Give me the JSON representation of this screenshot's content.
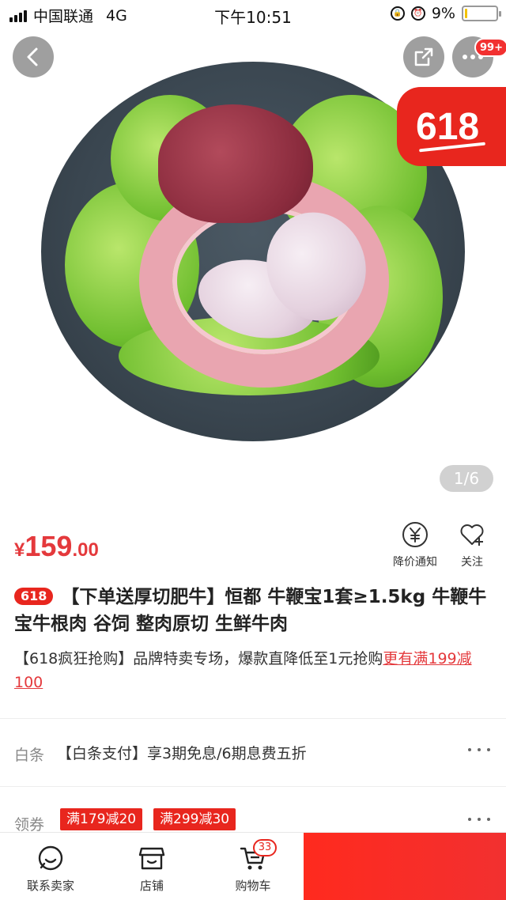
{
  "status_bar": {
    "carrier": "中国联通",
    "network": "4G",
    "time": "下午10:51",
    "battery_percent": "9%",
    "battery_level": 0.09
  },
  "gallery": {
    "pager": "1/6",
    "badge": "99+",
    "promo_tag": "618"
  },
  "price": {
    "currency": "¥",
    "integer": "159",
    "decimal": ".00"
  },
  "actions": {
    "price_alert": "降价通知",
    "follow": "关注"
  },
  "product": {
    "tag": "618",
    "title": "【下单送厚切肥牛】恒都 牛鞭宝1套≥1.5kg 牛鞭牛宝牛根肉 谷饲 整肉原切 生鲜牛肉"
  },
  "promo": {
    "text": "【618疯狂抢购】品牌特卖专场，爆款直降低至1元抢购",
    "link": "更有满199减100"
  },
  "baitiao": {
    "label": "白条",
    "value": "【白条支付】享3期免息/6期息费五折"
  },
  "coupons": {
    "label": "领券",
    "items": [
      "满179减20",
      "满299减30"
    ]
  },
  "bottom": {
    "contact": "联系卖家",
    "shop": "店铺",
    "cart": "购物车",
    "cart_count": "33"
  },
  "colors": {
    "accent": "#e4393c",
    "promo_red": "#e8261e"
  }
}
